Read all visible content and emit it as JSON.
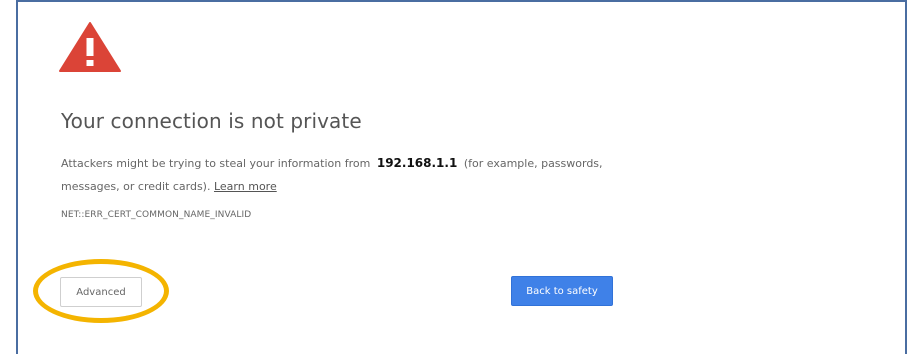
{
  "interstitial": {
    "title": "Your connection is not private",
    "description_before": "Attackers might be trying to steal your information from",
    "host": "192.168.1.1",
    "description_after": "(for example, passwords, messages, or credit cards).",
    "learn_more": "Learn more",
    "error_code": "NET::ERR_CERT_COMMON_NAME_INVALID",
    "advanced_label": "Advanced",
    "back_label": "Back to safety"
  },
  "colors": {
    "warning_red": "#db4437",
    "primary_button": "#3f81e8",
    "highlight_ring": "#f4b400",
    "frame_border": "#4a6da1"
  },
  "icons": {
    "warning": "warning-triangle-icon"
  }
}
